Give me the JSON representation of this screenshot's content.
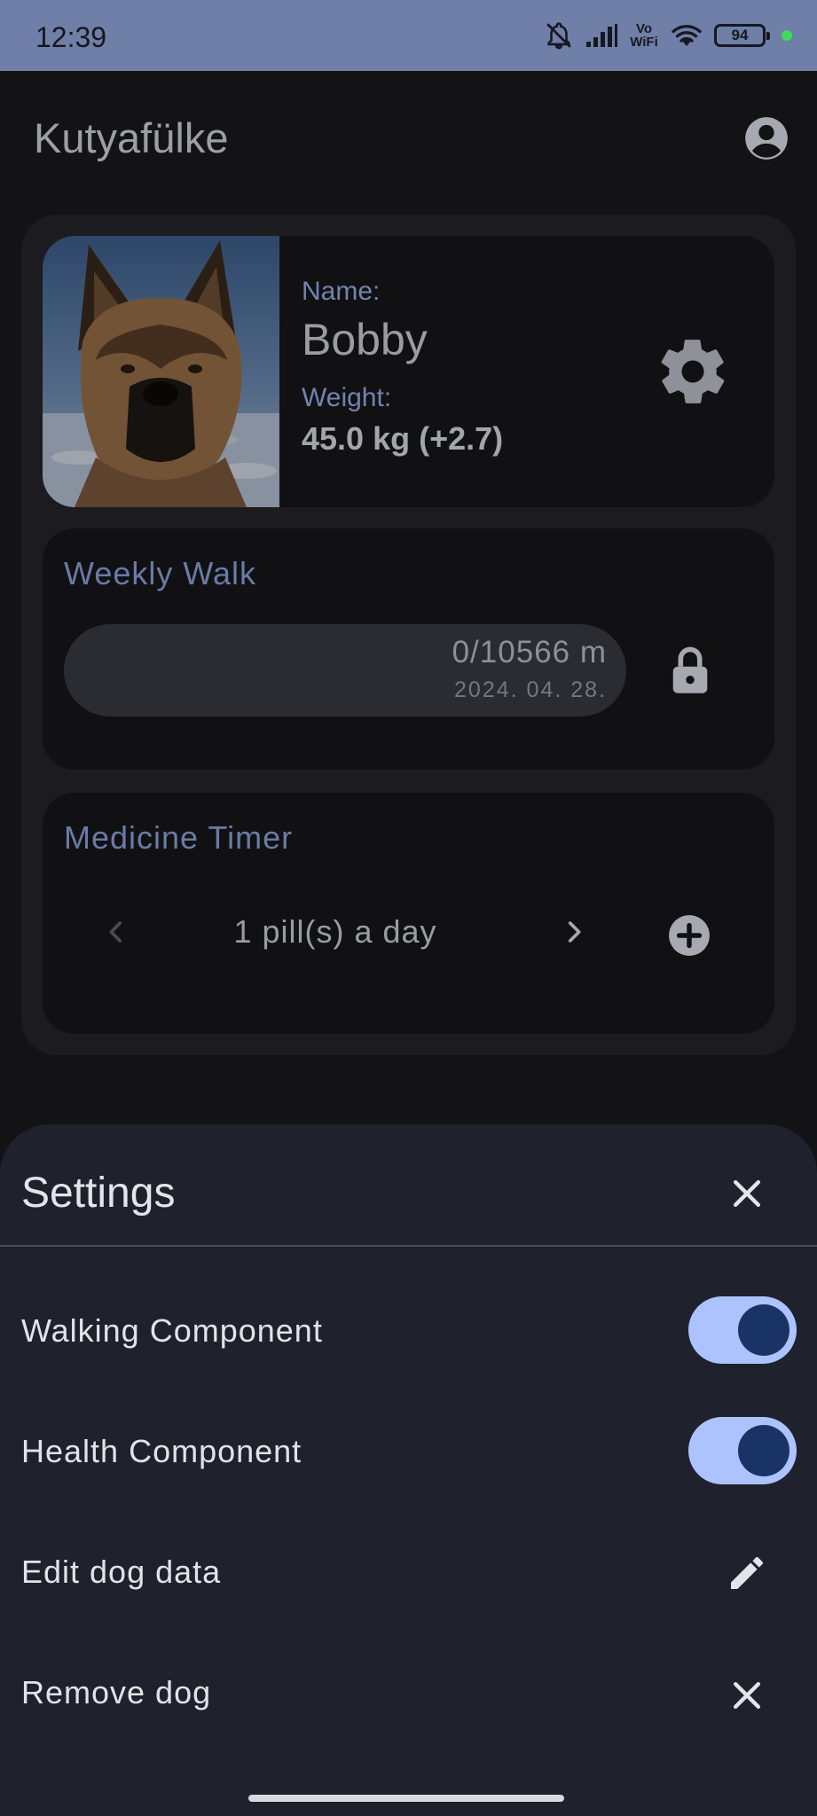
{
  "status_bar": {
    "time": "12:39",
    "network_label_top": "Vo",
    "network_label_bottom": "WiFi",
    "battery": "94"
  },
  "app": {
    "title": "Kutyafülke",
    "account_icon": "account-circle-icon"
  },
  "dog": {
    "name_label": "Name:",
    "name": "Bobby",
    "weight_label": "Weight:",
    "weight": "45.0 kg (+2.7)",
    "settings_icon": "gear-icon"
  },
  "weekly_walk": {
    "title": "Weekly Walk",
    "distance": "0/10566 m",
    "progress_fraction": 0,
    "date": "2024. 04. 28.",
    "lock_icon": "lock-icon"
  },
  "medicine_timer": {
    "title": "Medicine Timer",
    "schedule": "1 pill(s) a day",
    "prev_icon": "chevron-left-icon",
    "next_icon": "chevron-right-icon",
    "add_icon": "add-circle-icon"
  },
  "settings_sheet": {
    "title": "Settings",
    "rows": [
      {
        "label": "Walking Component",
        "control": "toggle",
        "on": true
      },
      {
        "label": "Health Component",
        "control": "toggle",
        "on": true
      },
      {
        "label": "Edit dog data",
        "control": "edit-icon"
      },
      {
        "label": "Remove dog",
        "control": "close-icon"
      }
    ]
  },
  "colors": {
    "status_bar": "#6f7fa8",
    "accent_label": "#7283ae",
    "toggle_track": "#adc3ff",
    "toggle_knob": "#1a3366",
    "sheet_bg": "#1f222c"
  }
}
